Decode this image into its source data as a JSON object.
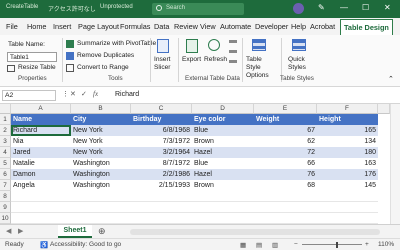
{
  "titlebar": {
    "file_name": "CreateTable",
    "saved_state": "アクセス許可なし",
    "unprotected": "Unprotected",
    "search_placeholder": "Search"
  },
  "tabs": [
    "File",
    "Home",
    "Insert",
    "Page Layout",
    "Formulas",
    "Data",
    "Review",
    "View",
    "Automate",
    "Developer",
    "Help",
    "Acrobat",
    "Table Design"
  ],
  "active_tab": "Table Design",
  "ribbon": {
    "table_name_label": "Table Name:",
    "table_name_value": "Table1",
    "resize_table": "Resize Table",
    "group_properties": "Properties",
    "summarize": "Summarize with PivotTable",
    "remove_duplicates": "Remove Duplicates",
    "convert_to_range": "Convert to Range",
    "group_tools": "Tools",
    "insert_slicer": "Insert Slicer",
    "export": "Export",
    "refresh": "Refresh",
    "group_external": "External Table Data",
    "table_style_options": "Table Style Options",
    "quick_styles": "Quick Styles",
    "group_table_styles": "Table Styles"
  },
  "formula_bar": {
    "cell_ref": "A2",
    "fx_label": "fx",
    "value": "Richard"
  },
  "columns": [
    "A",
    "B",
    "C",
    "D",
    "E",
    "F"
  ],
  "table": {
    "headers": [
      "Name",
      "City",
      "Birthday",
      "Eye color",
      "Weight",
      "Height"
    ],
    "rows": [
      [
        "Richard",
        "New York",
        "6/8/1968",
        "Blue",
        "67",
        "165"
      ],
      [
        "Nia",
        "New York",
        "7/3/1972",
        "Brown",
        "62",
        "134"
      ],
      [
        "Jared",
        "New York",
        "3/2/1964",
        "Hazel",
        "72",
        "180"
      ],
      [
        "Natalie",
        "Washington",
        "8/7/1972",
        "Blue",
        "66",
        "163"
      ],
      [
        "Damon",
        "Washington",
        "2/2/1986",
        "Hazel",
        "76",
        "176"
      ],
      [
        "Angela",
        "Washington",
        "2/15/1993",
        "Brown",
        "68",
        "145"
      ]
    ]
  },
  "row_numbers": [
    "1",
    "2",
    "3",
    "4",
    "5",
    "6",
    "7",
    "8",
    "9",
    "10"
  ],
  "sheet_tab": "Sheet1",
  "status": {
    "ready": "Ready",
    "accessibility": "Accessibility: Good to go",
    "zoom": "110%"
  },
  "colors": {
    "accent_green": "#1e6b3c",
    "table_header": "#4472c4",
    "table_band": "#d9e1f2"
  }
}
